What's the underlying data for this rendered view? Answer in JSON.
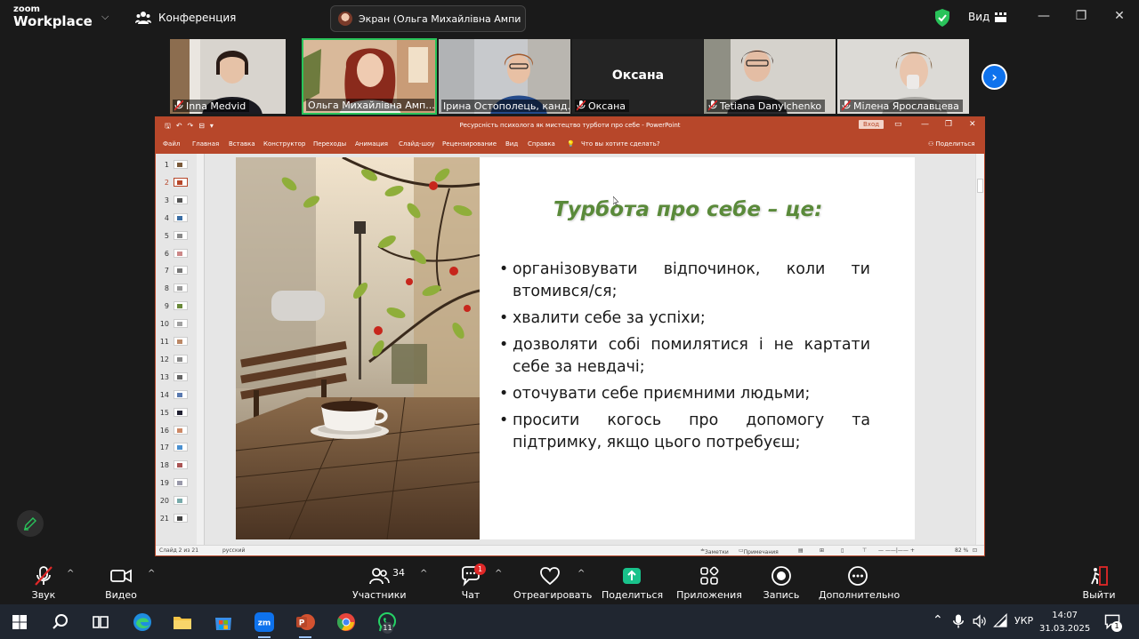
{
  "zoom": {
    "logo_top": "zoom",
    "logo_bottom": "Workplace",
    "conference_label": "Конференция",
    "screen_share_label": "Экран (Ольга Михайлівна Ампи",
    "view_label": "Вид"
  },
  "participants": [
    {
      "name": "Inna Medvid",
      "active": false
    },
    {
      "name": "Ольга Михайлівна Амп...",
      "active": true
    },
    {
      "name": "Ірина Остополець, канд...",
      "active": false
    },
    {
      "name": "Оксана",
      "display_name": "Оксана",
      "active": false
    },
    {
      "name": "Tetiana Danylchenko",
      "active": false
    },
    {
      "name": "Мілена Ярославцева",
      "active": false
    }
  ],
  "ppt": {
    "window_title": "Ресурсність психолога як мистецтво турботи про себе  -  PowerPoint",
    "login_label": "Вход",
    "menu": [
      "Файл",
      "Главная",
      "Вставка",
      "Конструктор",
      "Переходы",
      "Анимация",
      "Слайд-шоу",
      "Рецензирование",
      "Вид",
      "Справка"
    ],
    "tell_me": "Что вы хотите сделать?",
    "share_label": "Поделиться",
    "thumbnail_numbers": [
      "1",
      "2",
      "3",
      "4",
      "5",
      "6",
      "7",
      "8",
      "9",
      "10",
      "11",
      "12",
      "13",
      "14",
      "15",
      "16",
      "17",
      "18",
      "19",
      "20",
      "21"
    ],
    "selected_slide": 2,
    "status_slide": "Слайд 2 из 21",
    "status_lang": "русский",
    "status_notes": "Заметки",
    "status_comments": "Примечания",
    "zoom_level": "82 %",
    "slide": {
      "title": "Турбота про себе – це:",
      "bullets": [
        "організовувати відпочинок, коли ти втомився/ся;",
        "хвалити себе за успіхи;",
        "дозволяти собі помилятися і не картати себе за невдачі;",
        "оточувати себе приємними людьми;",
        "просити когось про допомогу та підтримку, якщо цього потребуєш;"
      ]
    }
  },
  "controls": {
    "mute": "Звук",
    "video": "Видео",
    "participants": "Участники",
    "participants_count": "34",
    "chat": "Чат",
    "chat_badge": "1",
    "react": "Отреагировать",
    "share": "Поделиться",
    "apps": "Приложения",
    "record": "Запись",
    "more": "Дополнительно",
    "leave": "Выйти"
  },
  "taskbar": {
    "whatsapp_badge": "11",
    "lang": "УКР",
    "time": "14:07",
    "date": "31.03.2025",
    "notification_count": "1"
  },
  "colors": {
    "zoom_bg": "#1a1a1a",
    "ppt_accent": "#b7472a",
    "title_green": "#5a8a3a",
    "active_green": "#29c35a",
    "zoom_blue": "#0e72ed",
    "share_green": "#19c28b",
    "taskbar_bg": "#202630"
  }
}
